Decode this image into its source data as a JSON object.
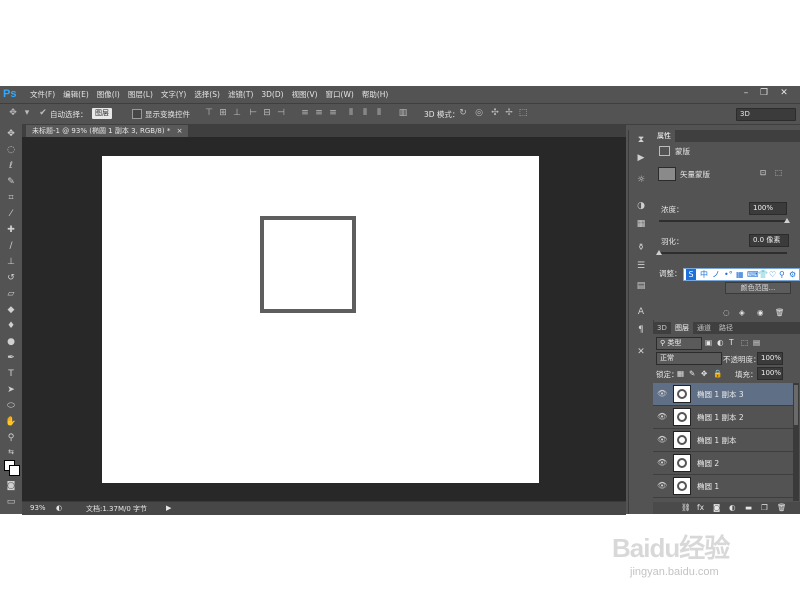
{
  "app": {
    "logo": "Ps"
  },
  "menu": [
    "文件(F)",
    "编辑(E)",
    "图像(I)",
    "图层(L)",
    "文字(Y)",
    "选择(S)",
    "滤镜(T)",
    "3D(D)",
    "视图(V)",
    "窗口(W)",
    "帮助(H)"
  ],
  "window_controls": {
    "minimize": "–",
    "restore": "❐",
    "close": "✕"
  },
  "options_bar": {
    "auto_select_label": "自动选择：",
    "auto_select_value": "图层",
    "show_transform_label": "显示变换控件",
    "mode_3d_label": "3D 模式：",
    "workspace_value": "3D"
  },
  "document": {
    "tab_title": "未标题-1 @ 93% (椭圆 1 副本 3, RGB/8) *",
    "tab_close": "×"
  },
  "status_bar": {
    "zoom": "93%",
    "doc_info": "文档:1.37M/0 字节"
  },
  "properties_panel": {
    "tab": "属性",
    "section": "蒙版",
    "vector_mask_label": "矢量蒙版",
    "density_label": "浓度：",
    "density_value": "100%",
    "density_fraction": 1.0,
    "feather_label": "羽化：",
    "feather_value": "0.0 像素",
    "feather_fraction": 0.0,
    "adjust_label": "调整：",
    "color_range_button": "颜色范围..."
  },
  "ime_bar": {
    "items": [
      "中",
      "ノ",
      "•°",
      "▦",
      "⌨",
      "👕",
      "♡",
      "⚲",
      "⚙"
    ]
  },
  "layers_panel": {
    "tabs": [
      "3D",
      "图层",
      "通道",
      "路径"
    ],
    "active_tab": "图层",
    "filter_kind": "类型",
    "blend_mode": "正常",
    "opacity_label": "不透明度：",
    "opacity_value": "100%",
    "lock_label": "锁定：",
    "fill_label": "填充：",
    "fill_value": "100%",
    "layers": [
      {
        "name": "椭圆 1 副本 3",
        "selected": true
      },
      {
        "name": "椭圆 1 副本 2",
        "selected": false
      },
      {
        "name": "椭圆 1 副本",
        "selected": false
      },
      {
        "name": "椭圆 2",
        "selected": false
      },
      {
        "name": "椭圆 1",
        "selected": false
      }
    ],
    "footer_icons": [
      "link-icon",
      "fx-icon",
      "mask-icon",
      "adjustment-icon",
      "group-icon",
      "new-layer-icon",
      "trash-icon"
    ]
  },
  "watermark": {
    "brand": "Baidu经验",
    "url": "jingyan.baidu.com"
  },
  "colors": {
    "accent_ps": "#31a8ff",
    "selected_layer": "#5f6f86",
    "panel_bg": "#535353",
    "canvas_bg": "#282828"
  }
}
